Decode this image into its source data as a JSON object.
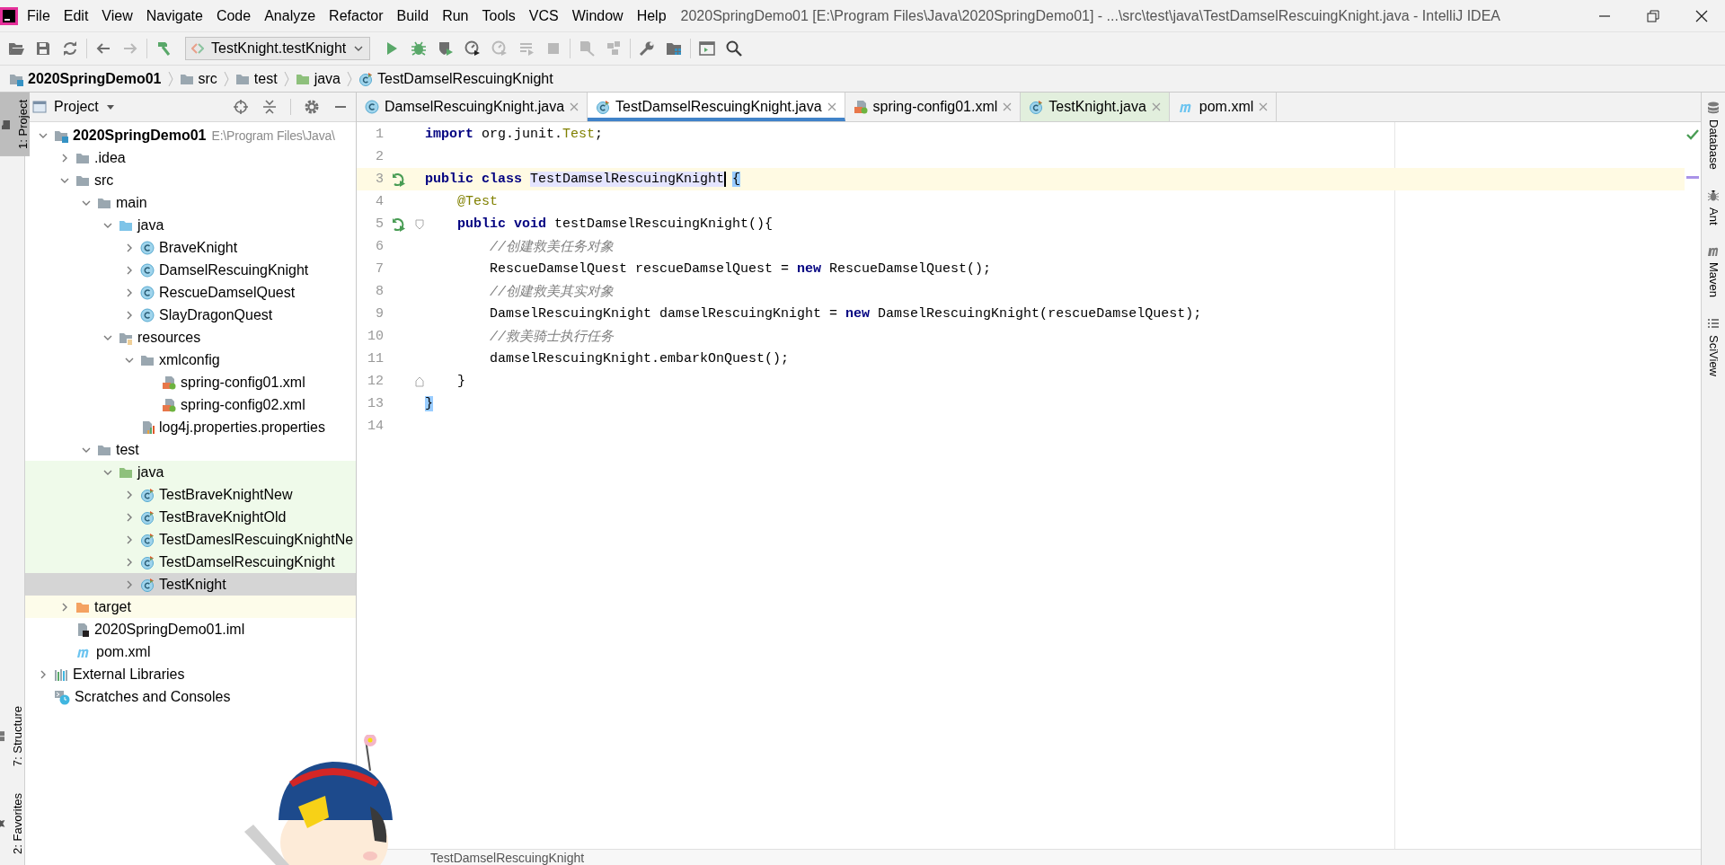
{
  "window": {
    "title": "2020SpringDemo01 [E:\\Program Files\\Java\\2020SpringDemo01] - ...\\src\\test\\java\\TestDamselRescuingKnight.java - IntelliJ IDEA"
  },
  "menu": [
    "File",
    "Edit",
    "View",
    "Navigate",
    "Code",
    "Analyze",
    "Refactor",
    "Build",
    "Run",
    "Tools",
    "VCS",
    "Window",
    "Help"
  ],
  "toolbar": {
    "groups": [
      [
        {
          "kind": "open",
          "disabled": false
        },
        {
          "kind": "save",
          "disabled": false
        },
        {
          "kind": "sync",
          "disabled": false
        }
      ],
      [
        {
          "kind": "back",
          "disabled": false
        },
        {
          "kind": "forward",
          "disabled": true
        }
      ],
      [
        {
          "kind": "build",
          "disabled": false
        },
        {
          "kind": "config",
          "label": "TestKnight.testKnight"
        },
        {
          "kind": "run",
          "disabled": false
        },
        {
          "kind": "debug",
          "disabled": false
        },
        {
          "kind": "coverage",
          "disabled": false
        },
        {
          "kind": "profile",
          "disabled": false
        },
        {
          "kind": "profile",
          "disabled": true
        },
        {
          "kind": "list",
          "disabled": true
        },
        {
          "kind": "stop",
          "disabled": true
        }
      ],
      [
        {
          "kind": "attach",
          "disabled": true
        },
        {
          "kind": "boxes",
          "disabled": true
        }
      ],
      [
        {
          "kind": "wrench",
          "disabled": false
        },
        {
          "kind": "structure",
          "disabled": false
        }
      ],
      [
        {
          "kind": "terminal",
          "disabled": false
        },
        {
          "kind": "search",
          "disabled": false
        }
      ]
    ]
  },
  "breadcrumbs": [
    {
      "label": "2020SpringDemo01",
      "kind": "module"
    },
    {
      "label": "src",
      "kind": "folder"
    },
    {
      "label": "test",
      "kind": "folder"
    },
    {
      "label": "java",
      "kind": "folder-test"
    },
    {
      "label": "TestDamselRescuingKnight",
      "kind": "test-class"
    }
  ],
  "left_strip": {
    "top": [
      {
        "label": "1: Project",
        "selected": true
      }
    ],
    "bottom": [
      {
        "label": "7: Structure",
        "selected": false
      },
      {
        "label": "2: Favorites",
        "selected": false
      }
    ]
  },
  "project_panel": {
    "title": "Project",
    "tree": [
      {
        "label": "2020SpringDemo01",
        "kind": "module",
        "path": "E:\\Program Files\\Java\\",
        "expanded": true,
        "selected": false,
        "children": [
          {
            "label": ".idea",
            "kind": "folder",
            "expanded": false,
            "selected": false
          },
          {
            "label": "src",
            "kind": "folder",
            "expanded": true,
            "selected": false,
            "children": [
              {
                "label": "main",
                "kind": "folder",
                "expanded": true,
                "selected": false,
                "children": [
                  {
                    "label": "java",
                    "kind": "folder-source",
                    "expanded": true,
                    "selected": false,
                    "children": [
                      {
                        "label": "BraveKnight",
                        "kind": "class",
                        "expanded": false,
                        "selected": false
                      },
                      {
                        "label": "DamselRescuingKnight",
                        "kind": "class",
                        "expanded": false,
                        "selected": false
                      },
                      {
                        "label": "RescueDamselQuest",
                        "kind": "class",
                        "expanded": false,
                        "selected": false
                      },
                      {
                        "label": "SlayDragonQuest",
                        "kind": "class",
                        "expanded": false,
                        "selected": false
                      }
                    ]
                  },
                  {
                    "label": "resources",
                    "kind": "folder-resources",
                    "expanded": true,
                    "selected": false,
                    "children": [
                      {
                        "label": "xmlconfig",
                        "kind": "folder",
                        "expanded": true,
                        "selected": false,
                        "children": [
                          {
                            "label": "spring-config01.xml",
                            "kind": "spring-xml",
                            "selected": false
                          },
                          {
                            "label": "spring-config02.xml",
                            "kind": "spring-xml",
                            "selected": false
                          }
                        ]
                      },
                      {
                        "label": "log4j.properties.properties",
                        "kind": "properties",
                        "selected": false
                      }
                    ]
                  }
                ]
              },
              {
                "label": "test",
                "kind": "folder",
                "expanded": true,
                "selected": false,
                "children": [
                  {
                    "label": "java",
                    "kind": "folder-test",
                    "color": "#effaea",
                    "expanded": true,
                    "selected": false,
                    "children": [
                      {
                        "label": "TestBraveKnightNew",
                        "kind": "test-class",
                        "color": "#effaea",
                        "expanded": false,
                        "selected": false
                      },
                      {
                        "label": "TestBraveKnightOld",
                        "kind": "test-class",
                        "color": "#effaea",
                        "expanded": false,
                        "selected": false
                      },
                      {
                        "label": "TestDameslRescuingKnightNe",
                        "kind": "test-class",
                        "color": "#effaea",
                        "expanded": false,
                        "selected": false
                      },
                      {
                        "label": "TestDamselRescuingKnight",
                        "kind": "test-class",
                        "color": "#effaea",
                        "expanded": false,
                        "selected": false
                      },
                      {
                        "label": "TestKnight",
                        "kind": "test-class",
                        "expanded": false,
                        "selected": true
                      }
                    ]
                  }
                ]
              }
            ]
          },
          {
            "label": "target",
            "kind": "folder-excluded",
            "color": "#fdfcea",
            "expanded": false,
            "selected": false
          },
          {
            "label": "2020SpringDemo01.iml",
            "kind": "iml",
            "selected": false
          },
          {
            "label": "pom.xml",
            "kind": "maven",
            "selected": false
          }
        ]
      },
      {
        "label": "External Libraries",
        "kind": "libraries",
        "expanded": false,
        "selected": false
      },
      {
        "label": "Scratches and Consoles",
        "kind": "scratches",
        "selected": false
      }
    ]
  },
  "tabs": [
    {
      "label": "DamselRescuingKnight.java",
      "kind": "class",
      "selected": false
    },
    {
      "label": "TestDamselRescuingKnight.java",
      "kind": "test-class",
      "selected": true
    },
    {
      "label": "spring-config01.xml",
      "kind": "spring-xml",
      "selected": false
    },
    {
      "label": "TestKnight.java",
      "kind": "test-class",
      "color": "#e2efdd",
      "selected": false
    },
    {
      "label": "pom.xml",
      "kind": "maven",
      "selected": false
    }
  ],
  "editor": {
    "lines": [
      {
        "number": "1",
        "current": false,
        "run_marker": false,
        "fold_start": false,
        "fold_end": false,
        "tokens": [
          {
            "text": "import",
            "kind": "keyword"
          },
          {
            "text": " org.junit.",
            "kind": "plain"
          },
          {
            "text": "Test",
            "kind": "annotation"
          },
          {
            "text": ";",
            "kind": "plain"
          }
        ]
      },
      {
        "number": "2",
        "current": false,
        "run_marker": false,
        "fold_start": false,
        "fold_end": false
      },
      {
        "number": "3",
        "current": true,
        "run_marker": true,
        "fold_start": false,
        "fold_end": false,
        "tokens": [
          {
            "text": "public",
            "kind": "keyword"
          },
          {
            "text": " class ",
            "kind": "keyword"
          },
          {
            "text": "TestDamselRescuingKnight",
            "kind": "usage"
          },
          {
            "text": "{",
            "kind": "brace"
          }
        ]
      },
      {
        "number": "4",
        "current": false,
        "run_marker": false,
        "fold_start": false,
        "fold_end": false,
        "tokens": [
          {
            "text": "    @Test",
            "kind": "annotation"
          }
        ]
      },
      {
        "number": "5",
        "current": false,
        "run_marker": true,
        "fold_start": true,
        "fold_end": false,
        "tokens": [
          {
            "text": "    public",
            "kind": "keyword"
          },
          {
            "text": " void",
            "kind": "keyword"
          },
          {
            "text": " testDamselRescuingKnight(){",
            "kind": "plain"
          }
        ]
      },
      {
        "number": "6",
        "current": false,
        "run_marker": false,
        "fold_start": false,
        "fold_end": false,
        "tokens": [
          {
            "text": "        //创建救美任务对象",
            "kind": "comment"
          }
        ]
      },
      {
        "number": "7",
        "current": false,
        "run_marker": false,
        "fold_start": false,
        "fold_end": false,
        "tokens": [
          {
            "text": "        RescueDamselQuest rescueDamselQuest = ",
            "kind": "plain"
          },
          {
            "text": "new",
            "kind": "keyword"
          },
          {
            "text": " RescueDamselQuest();",
            "kind": "plain"
          }
        ]
      },
      {
        "number": "8",
        "current": false,
        "run_marker": false,
        "fold_start": false,
        "fold_end": false,
        "tokens": [
          {
            "text": "        //创建救美其实对象",
            "kind": "comment"
          }
        ]
      },
      {
        "number": "9",
        "current": false,
        "run_marker": false,
        "fold_start": false,
        "fold_end": false,
        "tokens": [
          {
            "text": "        DamselRescuingKnight damselRescuingKnight = ",
            "kind": "plain"
          },
          {
            "text": "new",
            "kind": "keyword"
          },
          {
            "text": " DamselRescuingKnight(rescueDamselQuest);",
            "kind": "plain"
          }
        ]
      },
      {
        "number": "10",
        "current": false,
        "run_marker": false,
        "fold_start": false,
        "fold_end": false,
        "tokens": [
          {
            "text": "        //救美骑士执行任务",
            "kind": "comment"
          }
        ]
      },
      {
        "number": "11",
        "current": false,
        "run_marker": false,
        "fold_start": false,
        "fold_end": false,
        "tokens": [
          {
            "text": "        damselRescuingKnight.embarkOnQuest();",
            "kind": "plain"
          }
        ]
      },
      {
        "number": "12",
        "current": false,
        "run_marker": false,
        "fold_start": false,
        "fold_end": true,
        "tokens": [
          {
            "text": "    }",
            "kind": "plain"
          }
        ]
      },
      {
        "number": "13",
        "current": false,
        "run_marker": false,
        "fold_start": false,
        "fold_end": false,
        "tokens": [
          {
            "text": "}",
            "kind": "brace"
          }
        ]
      },
      {
        "number": "14",
        "current": false,
        "run_marker": false,
        "fold_start": false,
        "fold_end": false
      }
    ],
    "breadcrumb": "TestDamselRescuingKnight"
  },
  "right_strip": [
    {
      "label": "Database",
      "kind": "database"
    },
    {
      "label": "Ant",
      "kind": "ant"
    },
    {
      "label": "Maven",
      "kind": "maven"
    },
    {
      "label": "SciView",
      "kind": "grid"
    }
  ],
  "background": {
    "kind": "picture"
  }
}
